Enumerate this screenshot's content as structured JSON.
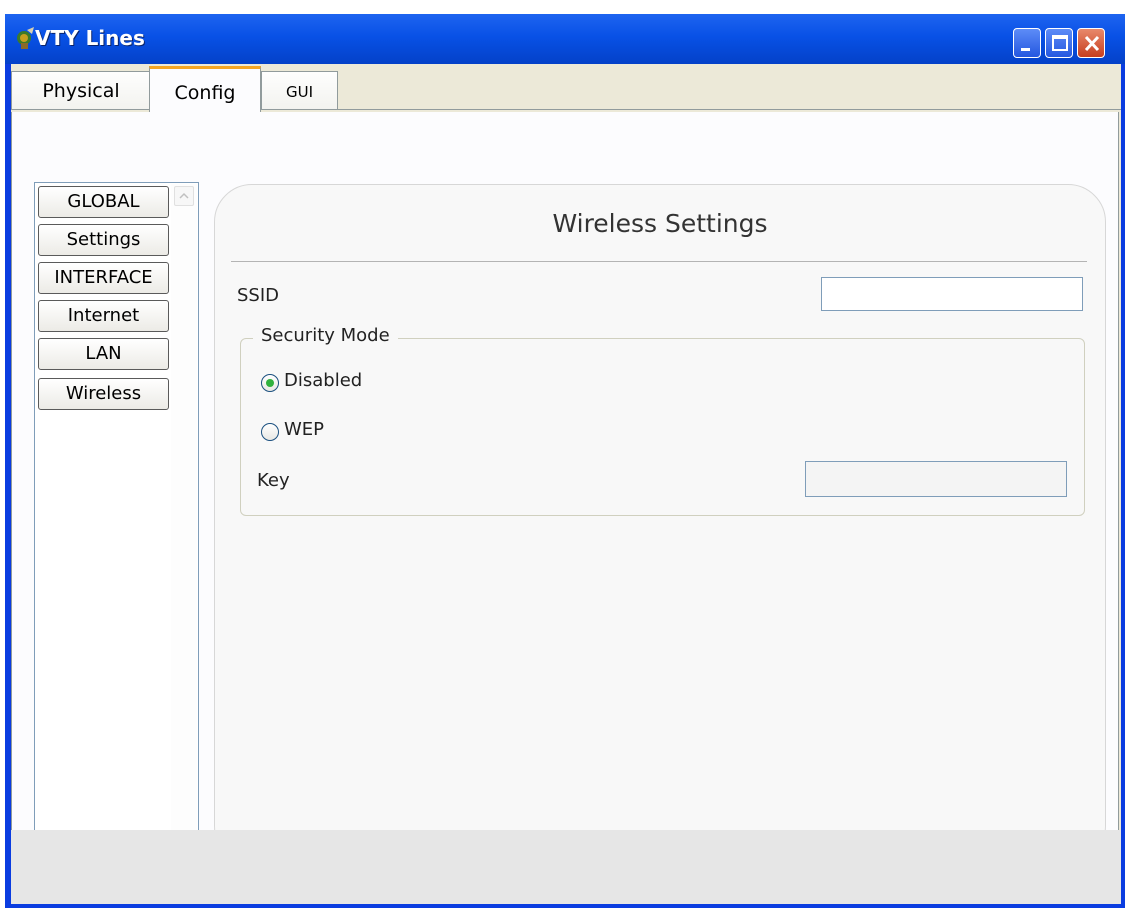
{
  "window": {
    "title": "VTY Lines"
  },
  "tabs": [
    {
      "label": "Physical",
      "selected": false
    },
    {
      "label": "Config",
      "selected": true
    },
    {
      "label": "GUI",
      "selected": false
    }
  ],
  "nav": {
    "items": [
      {
        "label": "GLOBAL"
      },
      {
        "label": "Settings"
      },
      {
        "label": "INTERFACE"
      },
      {
        "label": "Internet"
      },
      {
        "label": "LAN"
      },
      {
        "label": "Wireless"
      }
    ]
  },
  "wireless": {
    "title": "Wireless Settings",
    "ssid_label": "SSID",
    "ssid_value": "",
    "security_legend": "Security Mode",
    "mode_disabled_label": "Disabled",
    "mode_wep_label": "WEP",
    "selected_mode": "Disabled",
    "key_label": "Key",
    "key_value": ""
  },
  "colors": {
    "titlebar": "#0851e6",
    "active_tab_accent": "#f5a623",
    "radio_selected": "#30b13e"
  }
}
